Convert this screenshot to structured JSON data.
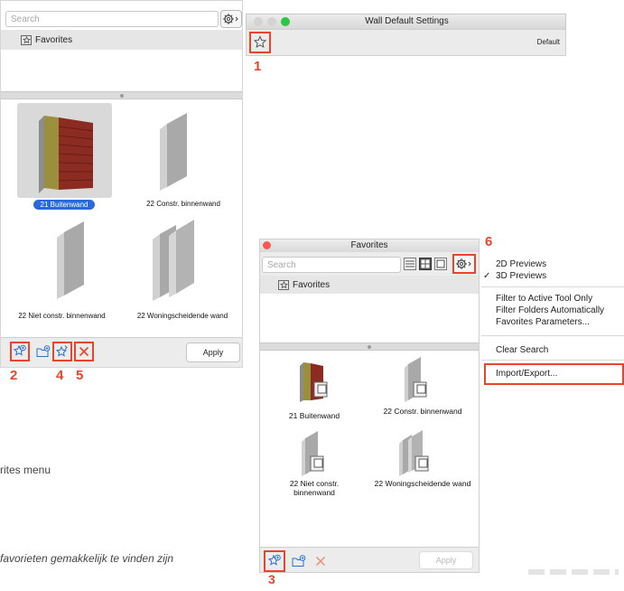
{
  "left_panel": {
    "search_placeholder": "Search",
    "favorites_folder": "Favorites",
    "items": [
      {
        "label": "21 Buitenwand",
        "selected": true
      },
      {
        "label": "22 Constr. binnenwand",
        "selected": false
      },
      {
        "label": "22 Niet constr. binnenwand",
        "selected": false
      },
      {
        "label": "22 Woningscheidende wand",
        "selected": false
      }
    ],
    "apply_label": "Apply"
  },
  "wall_settings": {
    "title": "Wall Default Settings",
    "default_label": "Default"
  },
  "favorites_window": {
    "title": "Favorites",
    "search_placeholder": "Search",
    "favorites_folder": "Favorites",
    "items": [
      {
        "label": "21 Buitenwand"
      },
      {
        "label": "22 Constr. binnenwand"
      },
      {
        "label": "22 Niet constr. binnenwand"
      },
      {
        "label": "22 Woningscheidende wand"
      }
    ],
    "apply_label": "Apply"
  },
  "settings_menu": {
    "items": [
      {
        "label": "2D Previews",
        "checked": false
      },
      {
        "label": "3D Previews",
        "checked": true
      },
      {
        "label": "Filter to Active Tool Only",
        "checked": false
      },
      {
        "label": "Filter Folders Automatically",
        "checked": false
      },
      {
        "label": "Favorites Parameters...",
        "checked": false
      },
      {
        "label": "Clear Search",
        "checked": false
      },
      {
        "label": "Import/Export...",
        "checked": false
      }
    ],
    "check_glyph": "✓"
  },
  "callouts": {
    "n1": "1",
    "n2": "2",
    "n3": "3",
    "n4": "4",
    "n5": "5",
    "n6": "6"
  },
  "background_text": {
    "menu_fragment": "rites menu",
    "caption_fragment": "favorieten gemakkelijk te vinden zijn"
  },
  "colors": {
    "accent": "#e8462c",
    "selection": "#2a6ad8"
  }
}
